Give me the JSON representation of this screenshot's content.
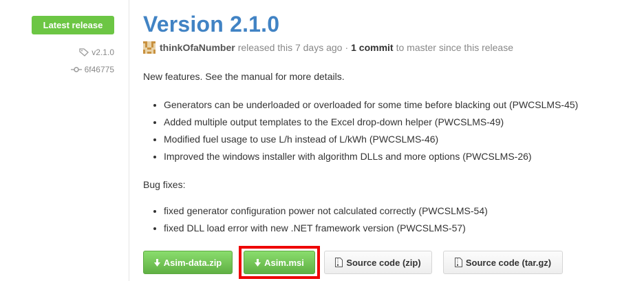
{
  "sidebar": {
    "badge": "Latest release",
    "tag": "v2.1.0",
    "commit": "6f46775"
  },
  "release": {
    "title": "Version 2.1.0",
    "author": "thinkOfaNumber",
    "released_text": "released this 7 days ago",
    "separator": "·",
    "commits": "1 commit",
    "commits_suffix": "to master since this release"
  },
  "notes": {
    "intro": "New features. See the manual for more details.",
    "features": [
      "Generators can be underloaded or overloaded for some time before blacking out (PWCSLMS-45)",
      "Added multiple output templates to the Excel drop-down helper (PWCSLMS-49)",
      "Modified fuel usage to use L/h instead of L/kWh (PWCSLMS-46)",
      "Improved the windows installer with algorithm DLLs and more options (PWCSLMS-26)"
    ],
    "bug_heading": "Bug fixes:",
    "bugs": [
      "fixed generator configuration power not calculated correctly (PWCSLMS-54)",
      "fixed DLL load error with new .NET framework version (PWCSLMS-57)"
    ]
  },
  "downloads": [
    {
      "label": "Asim-data.zip",
      "icon": "download-arrow-icon"
    },
    {
      "label": "Asim.msi",
      "icon": "download-arrow-icon"
    },
    {
      "label": "Source code (zip)",
      "icon": "zip-file-icon"
    },
    {
      "label": "Source code (tar.gz)",
      "icon": "zip-file-icon"
    }
  ],
  "colors": {
    "badge": "#6cc644",
    "title_link": "#4183c4",
    "download_button": "#60b044",
    "highlight": "#ee0000"
  }
}
